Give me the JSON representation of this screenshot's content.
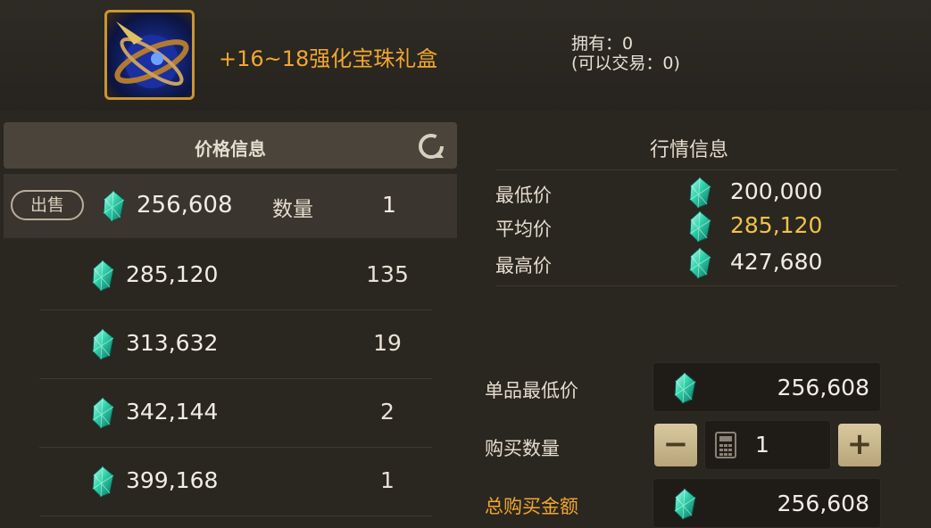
{
  "item": {
    "name": "+16~18强化宝珠礼盒",
    "owned": "拥有：0",
    "tradable": "(可以交易：0)"
  },
  "price_panel": {
    "title": "价格信息",
    "sell_label": "出售",
    "sell_price": "256,608",
    "qty_label": "数量",
    "sell_qty": "1",
    "listings": [
      {
        "price": "285,120",
        "qty": "135"
      },
      {
        "price": "313,632",
        "qty": "19"
      },
      {
        "price": "342,144",
        "qty": "2"
      },
      {
        "price": "399,168",
        "qty": "1"
      }
    ]
  },
  "market": {
    "title": "行情信息",
    "min_label": "最低价",
    "min_value": "200,000",
    "avg_label": "平均价",
    "avg_value": "285,120",
    "max_label": "最高价",
    "max_value": "427,680"
  },
  "purchase": {
    "unit_min_label": "单品最低价",
    "unit_min_value": "256,608",
    "qty_label": "购买数量",
    "qty_value": "1",
    "minus": "−",
    "plus": "+",
    "total_label": "总购买金额",
    "total_value": "256,608"
  },
  "colors": {
    "accent_gold": "#f0a830",
    "avg_price": "#f0c24a",
    "background": "#2a2620",
    "gem": "#3fd6b0"
  },
  "icons": [
    "gem-icon",
    "refresh-icon",
    "calculator-icon",
    "item-orb-icon"
  ]
}
